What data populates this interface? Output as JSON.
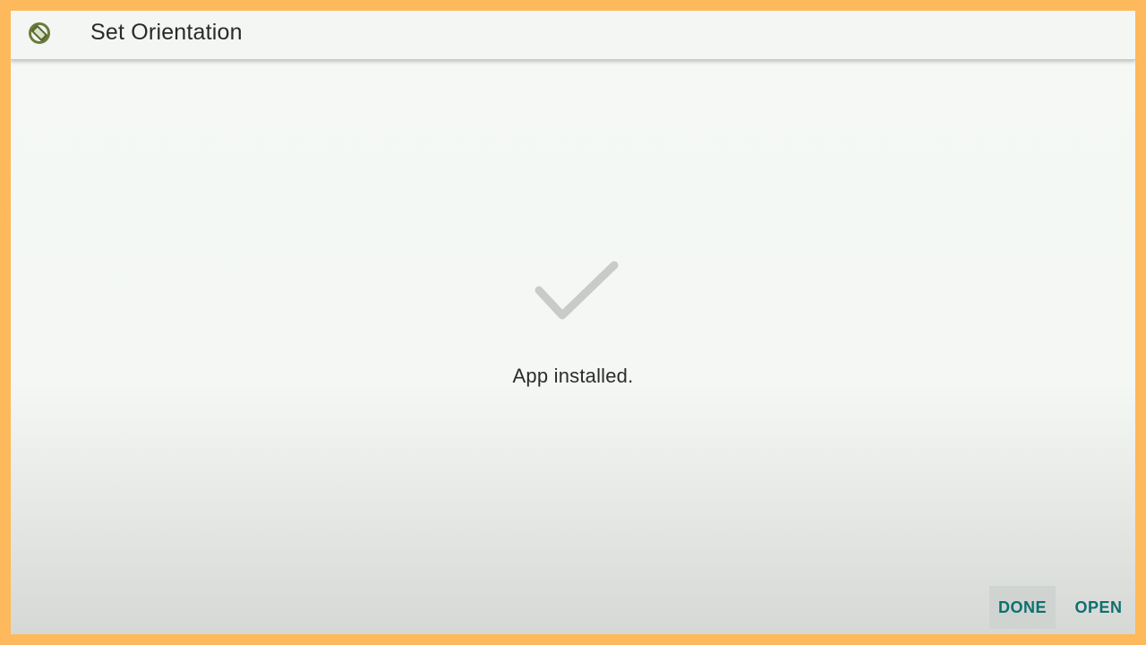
{
  "app_bar": {
    "icon": "rotation-app-icon",
    "title": "Set Orientation"
  },
  "main": {
    "status_icon": "checkmark-icon",
    "status_text": "App installed."
  },
  "actions": {
    "done_label": "DONE",
    "open_label": "OPEN"
  },
  "colors": {
    "frame": "#fdb95c",
    "accent": "#0e6f6f",
    "check": "#c9cbc8"
  }
}
